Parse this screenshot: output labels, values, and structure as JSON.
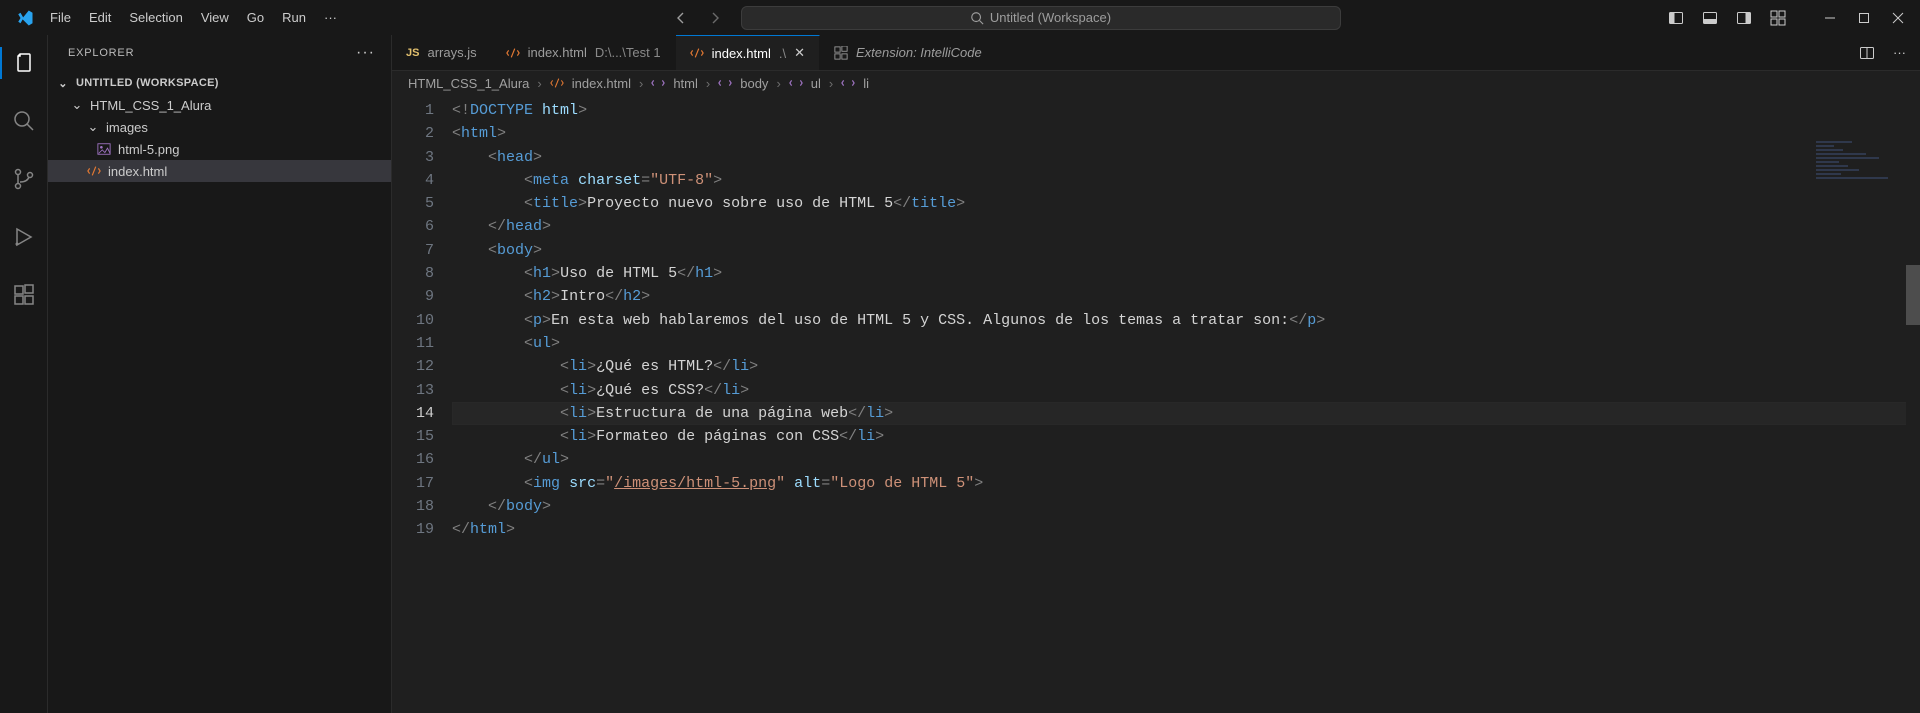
{
  "title_bar": {
    "menu": [
      "File",
      "Edit",
      "Selection",
      "View",
      "Go",
      "Run"
    ],
    "search_placeholder": "Untitled (Workspace)"
  },
  "sidebar": {
    "title": "EXPLORER",
    "root": "UNTITLED (WORKSPACE)",
    "folder1": "HTML_CSS_1_Alura",
    "folder2": "images",
    "file_img": "html-5.png",
    "file_html": "index.html"
  },
  "tabs": {
    "t1_label": "arrays.js",
    "t2_label": "index.html",
    "t2_path": "D:\\...\\Test 1",
    "t3_label": "index.html",
    "t3_path": ".\\",
    "t4_label": "Extension: IntelliCode"
  },
  "breadcrumbs": {
    "p1": "HTML_CSS_1_Alura",
    "p2": "index.html",
    "p3": "html",
    "p4": "body",
    "p5": "ul",
    "p6": "li"
  },
  "code": {
    "title_text": "Proyecto nuevo sobre uso de HTML 5",
    "h1_text": "Uso de HTML 5",
    "h2_text": "Intro",
    "p_text": "En esta web hablaremos del uso de HTML 5 y CSS. Algunos de los temas a tratar son:",
    "li1": "¿Qué es HTML?",
    "li2": "¿Qué es CSS?",
    "li3": "Estructura de una página web",
    "li4": "Formateo de páginas con CSS",
    "img_src": "/images/html-5.png",
    "img_alt": "Logo de HTML 5",
    "charset": "UTF-8"
  },
  "line_numbers": [
    "1",
    "2",
    "3",
    "4",
    "5",
    "6",
    "7",
    "8",
    "9",
    "10",
    "11",
    "12",
    "13",
    "14",
    "15",
    "16",
    "17",
    "18",
    "19"
  ],
  "current_line_index": 13
}
